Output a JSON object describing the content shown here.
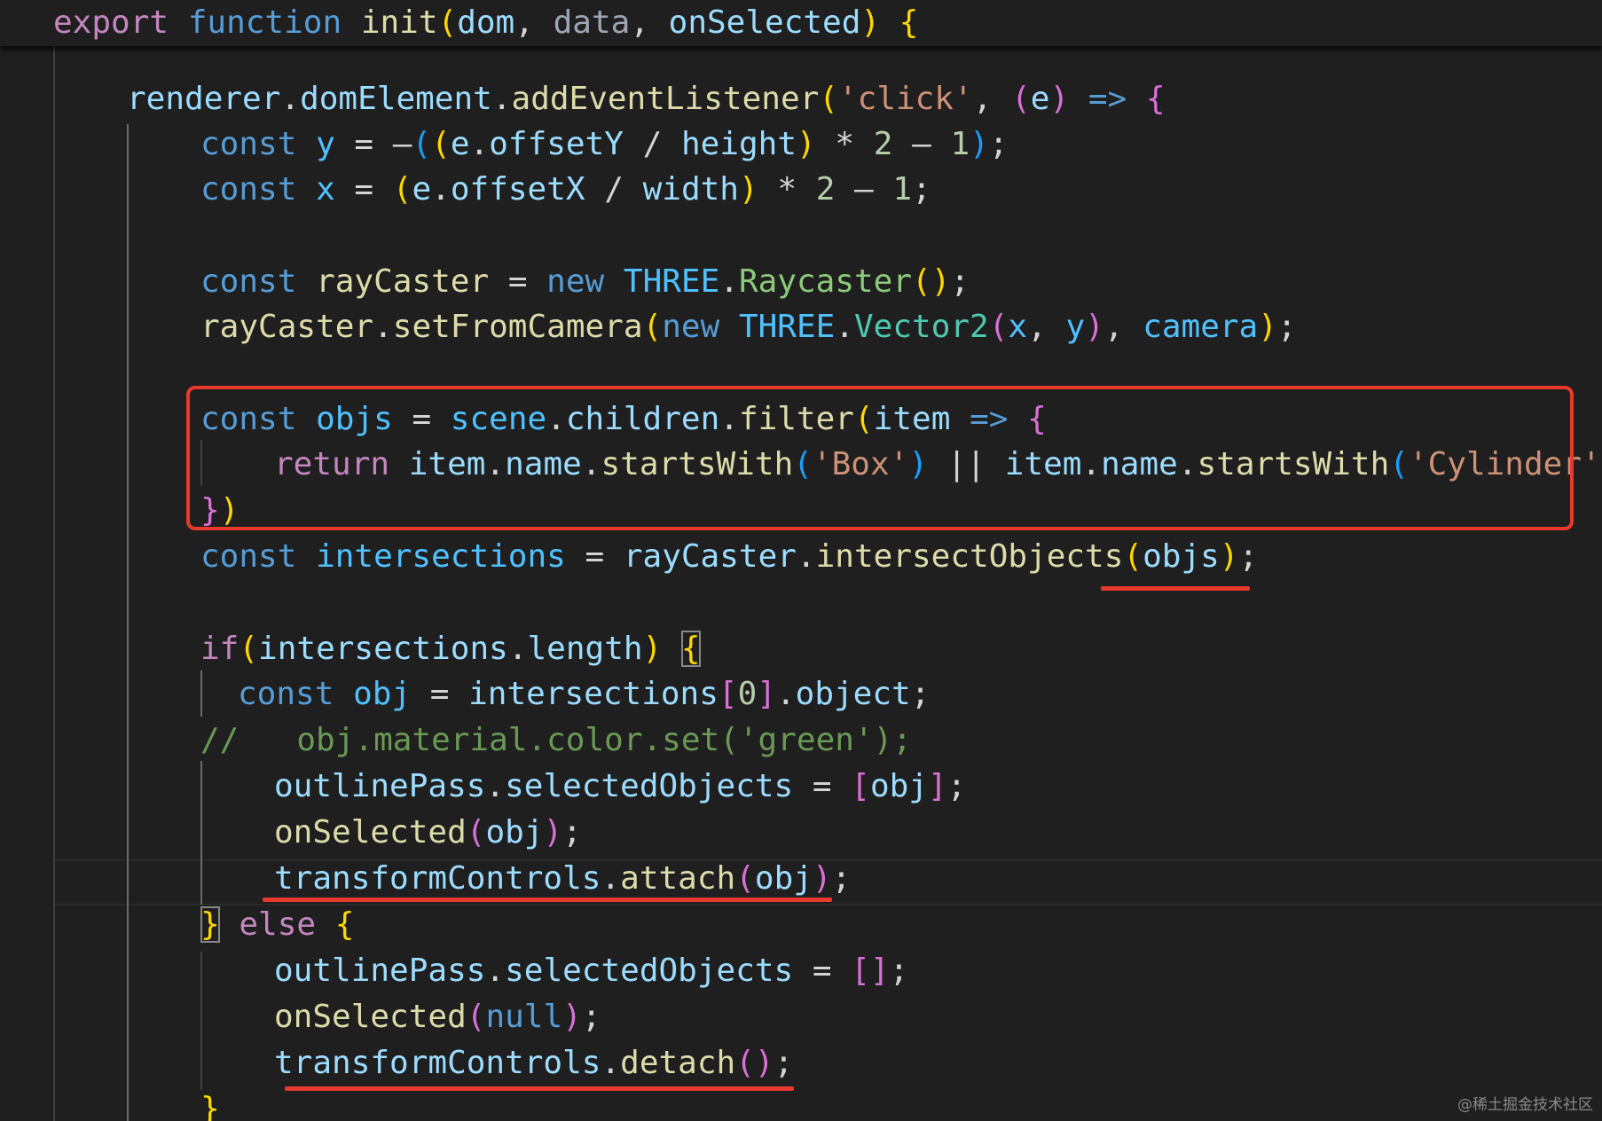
{
  "code": {
    "l1": {
      "export": "export",
      "function": "function",
      "name": "init",
      "open": "(",
      "p1": "dom",
      "c1": ", ",
      "p2": "data",
      "c2": ", ",
      "p3": "onSelected",
      "close": ")",
      "brace": "{"
    },
    "l3": {
      "obj": "renderer",
      "d1": ".",
      "prop": "domElement",
      "d2": ".",
      "method": "addEventListener",
      "open": "(",
      "str": "'click'",
      "comma": ", ",
      "popen": "(",
      "param": "e",
      "pclose": ")",
      "arrow": "=>",
      "brace": "{"
    },
    "l4": {
      "const": "const",
      "name": "y",
      "eq": " = ",
      "minus": "–",
      "o1": "(",
      "o2": "(",
      "e": "e",
      "d": ".",
      "prop": "offsetY",
      "div": " / ",
      "h": "height",
      "c2": ")",
      "mul": " * ",
      "two": "2",
      "sub": " – ",
      "one": "1",
      "c1": ")",
      "semi": ";"
    },
    "l5": {
      "const": "const",
      "name": "x",
      "eq": " = ",
      "o1": "(",
      "e": "e",
      "d": ".",
      "prop": "offsetX",
      "div": " / ",
      "w": "width",
      "c1": ")",
      "mul": " * ",
      "two": "2",
      "sub": " – ",
      "one": "1",
      "semi": ";"
    },
    "l7": {
      "const": "const",
      "name": "rayCaster",
      "eq": " = ",
      "new": "new",
      "ns": "THREE",
      "d": ".",
      "cls": "Raycaster",
      "open": "(",
      "close": ")",
      "semi": ";"
    },
    "l8": {
      "obj": "rayCaster",
      "d": ".",
      "method": "setFromCamera",
      "open": "(",
      "new": "new",
      "ns": "THREE",
      "d2": ".",
      "cls": "Vector2",
      "o2": "(",
      "x": "x",
      "comma": ", ",
      "y": "y",
      "c2": ")",
      "comma2": ", ",
      "cam": "camera",
      "close": ")",
      "semi": ";"
    },
    "l10": {
      "const": "const",
      "name": "objs",
      "eq": " = ",
      "scene": "scene",
      "d1": ".",
      "children": "children",
      "d2": ".",
      "filter": "filter",
      "open": "(",
      "item": "item",
      "arrow": "=>",
      "brace": "{"
    },
    "l11": {
      "return": "return",
      "item1": "item",
      "d1": ".",
      "name1": "name",
      "d2": ".",
      "sw1": "startsWith",
      "o1": "(",
      "s1": "'Box'",
      "c1": ")",
      "or": " || ",
      "item2": "item",
      "d3": ".",
      "name2": "name",
      "d4": ".",
      "sw2": "startsWith",
      "o2": "(",
      "s2": "'Cylinder'",
      "c2": ")"
    },
    "l12": {
      "brace": "}",
      "paren": ")"
    },
    "l13": {
      "const": "const",
      "name": "intersections",
      "eq": " = ",
      "obj": "rayCaster",
      "d": ".",
      "method": "intersectObjects",
      "open": "(",
      "arg": "objs",
      "close": ")",
      "semi": ";"
    },
    "l15": {
      "if": "if",
      "open": "(",
      "obj": "intersections",
      "d": ".",
      "prop": "length",
      "close": ")",
      "brace": "{"
    },
    "l16": {
      "const": "const",
      "name": "obj",
      "eq": " = ",
      "arr": "intersections",
      "bo": "[",
      "idx": "0",
      "bc": "]",
      "d": ".",
      "prop": "object",
      "semi": ";"
    },
    "l17": {
      "comment": "//   obj.material.color.set('green');"
    },
    "l18": {
      "obj": "outlinePass",
      "d": ".",
      "prop": "selectedObjects",
      "eq": " = ",
      "bo": "[",
      "val": "obj",
      "bc": "]",
      "semi": ";"
    },
    "l19": {
      "fn": "onSelected",
      "open": "(",
      "arg": "obj",
      "close": ")",
      "semi": ";"
    },
    "l20": {
      "obj": "transformControls",
      "d": ".",
      "method": "attach",
      "open": "(",
      "arg": "obj",
      "close": ")",
      "semi": ";"
    },
    "l21": {
      "brace": "}",
      "else": "else",
      "brace2": "{"
    },
    "l22": {
      "obj": "outlinePass",
      "d": ".",
      "prop": "selectedObjects",
      "eq": " = ",
      "arr": "[]",
      "semi": ";"
    },
    "l23": {
      "fn": "onSelected",
      "open": "(",
      "arg": "null",
      "close": ")",
      "semi": ";"
    },
    "l24": {
      "obj": "transformControls",
      "d": ".",
      "method": "detach",
      "paren": "()",
      "semi": ";"
    },
    "l25": {
      "brace": "}"
    }
  },
  "watermark": "@稀土掘金技术社区",
  "colors": {
    "background": "#1f1f1f",
    "keyword": "#c586c0",
    "storage": "#569cd6",
    "function": "#dcdcaa",
    "variable": "#9cdcfe",
    "string": "#ce9178",
    "number": "#b5cea8",
    "comment": "#6a9955",
    "class": "#4ec9b0",
    "annotation": "#e8392c"
  }
}
